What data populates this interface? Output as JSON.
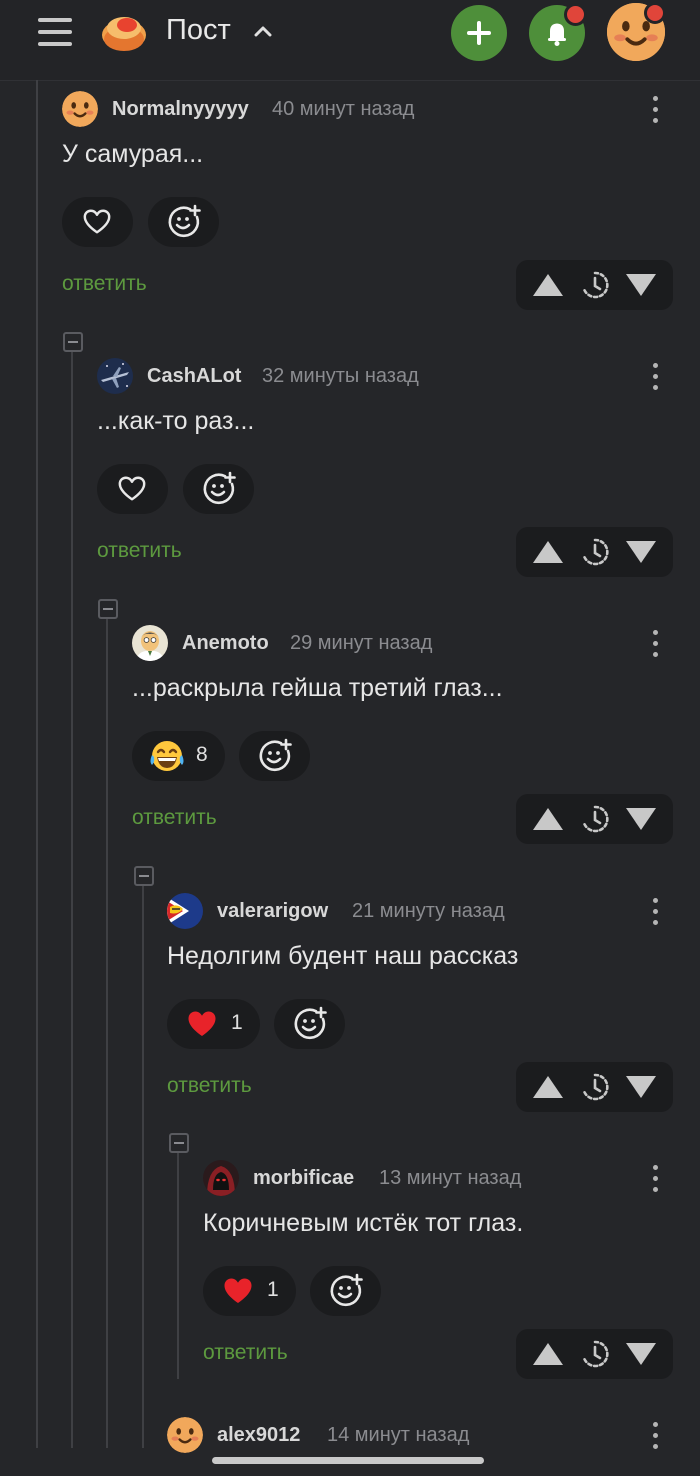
{
  "header": {
    "title": "Пост",
    "logo_icon": "pikabu-logo-icon",
    "add_icon": "plus-icon",
    "bell_icon": "bell-icon"
  },
  "colors": {
    "background": "#252629",
    "accent": "#4e8f3a",
    "reply": "#5d9a3f",
    "badge": "#e0453a"
  },
  "comments": [
    {
      "author": "Normalnyyyyy",
      "time": "40 минут назад",
      "text": "У самурая...",
      "reaction": {
        "icon": "heart-outline-icon",
        "count": ""
      },
      "reply": "ответить"
    },
    {
      "author": "CashALot",
      "time": "32 минуты назад",
      "text": "...как-то раз...",
      "reaction": {
        "icon": "heart-outline-icon",
        "count": ""
      },
      "reply": "ответить"
    },
    {
      "author": "Anemoto",
      "time": "29 минут назад",
      "text": "...раскрыла гейша третий глаз...",
      "reaction": {
        "icon": "laughing-emoji-icon",
        "count": "8"
      },
      "reply": "ответить"
    },
    {
      "author": "valerarigow",
      "time": "21 минуту назад",
      "text": "Недолгим будент наш рассказ",
      "reaction": {
        "icon": "heart-filled-icon",
        "count": "1"
      },
      "reply": "ответить"
    },
    {
      "author": "morbificae",
      "time": "13 минут назад",
      "text": "Коричневым истёк тот глаз.",
      "reaction": {
        "icon": "heart-filled-icon",
        "count": "1"
      },
      "reply": "ответить"
    },
    {
      "author": "alex9012",
      "time": "14 минут назад"
    }
  ]
}
